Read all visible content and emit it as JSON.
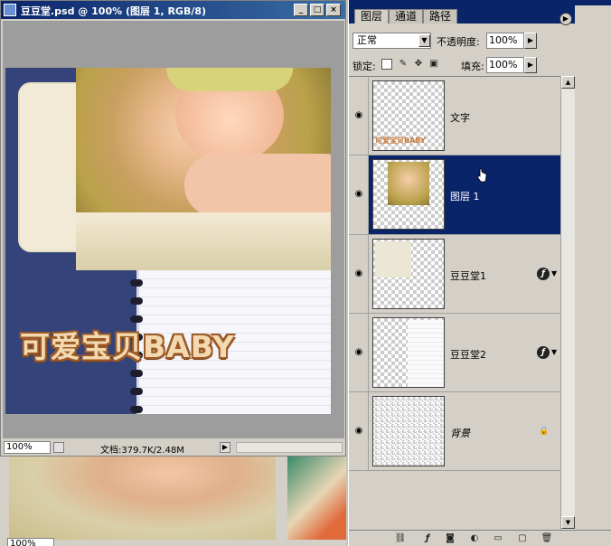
{
  "document": {
    "title": "豆豆堂.psd @ 100% (图层 1, RGB/8)",
    "zoom": "100%",
    "doc_info": "文档:379.7K/2.48M",
    "canvas_text": "可爱宝贝BABY",
    "window_buttons": [
      "_",
      "□",
      "×"
    ]
  },
  "document2": {
    "zoom": "100%"
  },
  "layers_panel": {
    "tabs": [
      {
        "label": "图层",
        "active": true
      },
      {
        "label": "通道",
        "active": false
      },
      {
        "label": "路径",
        "active": false
      }
    ],
    "blend_mode": "正常",
    "opacity_label": "不透明度:",
    "opacity_value": "100%",
    "lock_label": "锁定:",
    "fill_label": "填充:",
    "fill_value": "100%",
    "layers": [
      {
        "name": "文字",
        "visible": true,
        "selected": false,
        "has_fx": false,
        "locked": false
      },
      {
        "name": "图层 1",
        "visible": true,
        "selected": true,
        "has_fx": false,
        "locked": false
      },
      {
        "name": "豆豆堂1",
        "visible": true,
        "selected": false,
        "has_fx": true,
        "locked": false
      },
      {
        "name": "豆豆堂2",
        "visible": true,
        "selected": false,
        "has_fx": true,
        "locked": false
      },
      {
        "name": "背景",
        "visible": true,
        "selected": false,
        "has_fx": false,
        "locked": true
      }
    ],
    "thumb_text_label": "可爱宝贝BABY",
    "bottom_icons": [
      "link-icon",
      "layer-style-icon",
      "mask-icon",
      "adjustment-icon",
      "folder-icon",
      "new-layer-icon",
      "trash-icon"
    ]
  },
  "colors": {
    "selection": "#0a246a",
    "canvas_blue": "#34447a",
    "text_fill": "#f3d9b0",
    "text_stroke": "#9c5a26"
  }
}
